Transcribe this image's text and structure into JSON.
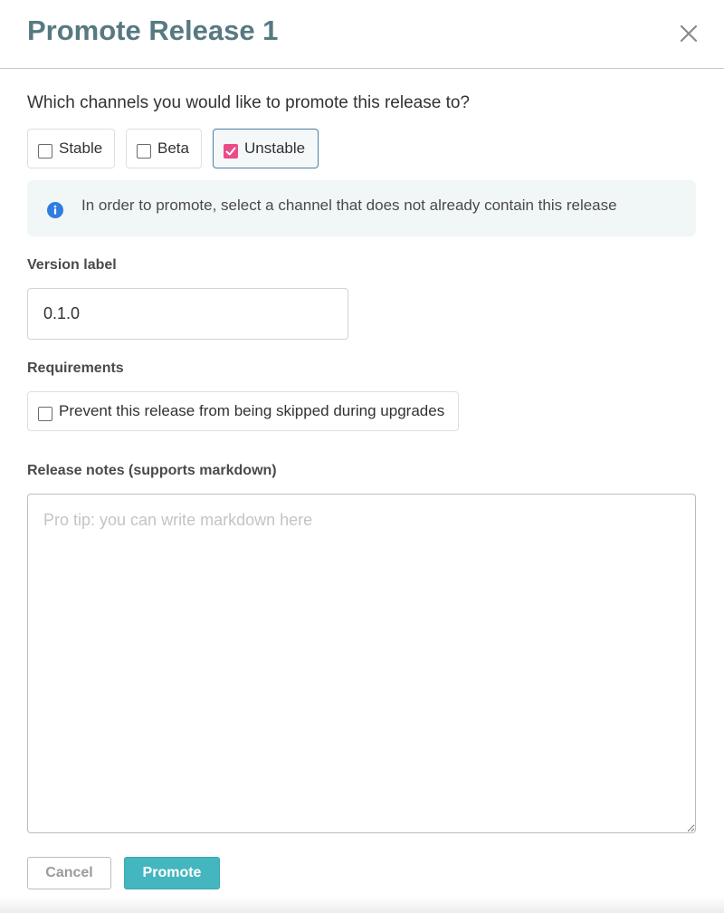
{
  "modal": {
    "title": "Promote Release 1",
    "close_icon": "close-icon"
  },
  "channels": {
    "question": "Which channels you would like to promote this release to?",
    "options": [
      {
        "label": "Stable",
        "checked": false
      },
      {
        "label": "Beta",
        "checked": false
      },
      {
        "label": "Unstable",
        "checked": true
      }
    ],
    "checked_color": "#ea4b8b"
  },
  "info": {
    "icon": "info-icon",
    "text": "In order to promote, select a channel that does not already contain this release"
  },
  "version": {
    "label": "Version label",
    "value": "0.1.0"
  },
  "requirements": {
    "label": "Requirements",
    "option_label": "Prevent this release from being skipped during upgrades",
    "checked": false
  },
  "release_notes": {
    "label": "Release notes (supports markdown)",
    "placeholder": "Pro tip: you can write markdown here",
    "value": ""
  },
  "buttons": {
    "cancel": "Cancel",
    "promote": "Promote"
  },
  "colors": {
    "title": "#577981",
    "promote_button": "#44b6bf",
    "info_icon": "#2f7de1",
    "info_background": "#f1f6f7",
    "selected_border": "#4a7fa3"
  }
}
